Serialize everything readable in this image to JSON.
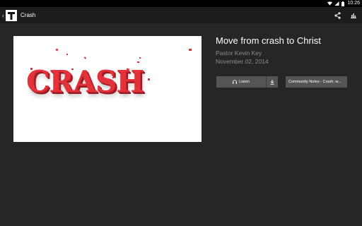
{
  "status_bar": {
    "time": "10:26",
    "icons": [
      "wifi-icon",
      "signal-icon",
      "battery-icon"
    ]
  },
  "action_bar": {
    "title": "Crash",
    "up_icon": "chevron-left-icon",
    "logo_icon": "cross-logo-icon",
    "actions": [
      "share-icon",
      "bar-chart-icon"
    ]
  },
  "sermon": {
    "artwork_text": "CRASH",
    "title": "Move from crash to Christ",
    "speaker": "Pastor Kevin Key",
    "date": "November 02, 2014"
  },
  "buttons": {
    "listen_label": "Listen",
    "listen_icon": "headphones-icon",
    "download_icon": "download-icon",
    "notes_label": "Community Notes - Crash, w..."
  },
  "colors": {
    "background": "#262626",
    "action_bar": "#1c1c1c",
    "button": "#555555",
    "accent": "#e4323b"
  }
}
